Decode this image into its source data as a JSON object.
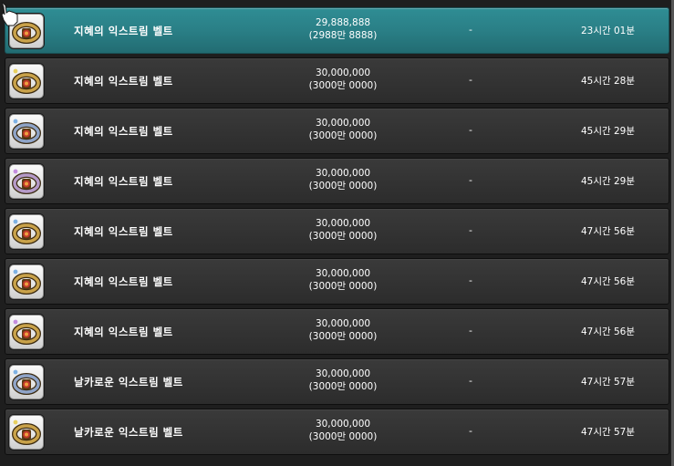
{
  "colors": {
    "selected_row": "#2a7f86",
    "row": "#333333",
    "text": "#ffffff",
    "belt_gold": "#c9a24a",
    "gem_red": "#c0392b"
  },
  "listings": [
    {
      "name": "지혜의 익스트림 벨트",
      "price": "29,888,888",
      "price_korean": "(2988만 8888)",
      "extra": "-",
      "time_left": "23시간 01분",
      "gem_color": "#7fb2e5",
      "icon": "extreme-belt-icon"
    },
    {
      "name": "지혜의 익스트림 벨트",
      "price": "30,000,000",
      "price_korean": "(3000만 0000)",
      "extra": "-",
      "time_left": "45시간 28분",
      "gem_color": "#e8d060",
      "icon": "extreme-belt-icon"
    },
    {
      "name": "지혜의 익스트림 벨트",
      "price": "30,000,000",
      "price_korean": "(3000만 0000)",
      "extra": "-",
      "time_left": "45시간 29분",
      "gem_color": "#7fb2e5",
      "icon": "extreme-belt-icon"
    },
    {
      "name": "지혜의 익스트림 벨트",
      "price": "30,000,000",
      "price_korean": "(3000만 0000)",
      "extra": "-",
      "time_left": "45시간 29분",
      "gem_color": "#c58ee0",
      "icon": "extreme-belt-icon"
    },
    {
      "name": "지혜의 익스트림 벨트",
      "price": "30,000,000",
      "price_korean": "(3000만 0000)",
      "extra": "-",
      "time_left": "47시간 56분",
      "gem_color": "#7fb2e5",
      "icon": "extreme-belt-icon"
    },
    {
      "name": "지혜의 익스트림 벨트",
      "price": "30,000,000",
      "price_korean": "(3000만 0000)",
      "extra": "-",
      "time_left": "47시간 56분",
      "gem_color": "#7fb2e5",
      "icon": "extreme-belt-icon"
    },
    {
      "name": "지혜의 익스트림 벨트",
      "price": "30,000,000",
      "price_korean": "(3000만 0000)",
      "extra": "-",
      "time_left": "47시간 56분",
      "gem_color": "#c58ee0",
      "icon": "extreme-belt-icon"
    },
    {
      "name": "날카로운 익스트림 벨트",
      "price": "30,000,000",
      "price_korean": "(3000만 0000)",
      "extra": "-",
      "time_left": "47시간 57분",
      "gem_color": "#7fb2e5",
      "icon": "extreme-belt-icon"
    },
    {
      "name": "날카로운 익스트림 벨트",
      "price": "30,000,000",
      "price_korean": "(3000만 0000)",
      "extra": "-",
      "time_left": "47시간 57분",
      "gem_color": "#e8d060",
      "icon": "extreme-belt-icon"
    }
  ],
  "selected_index": 0
}
